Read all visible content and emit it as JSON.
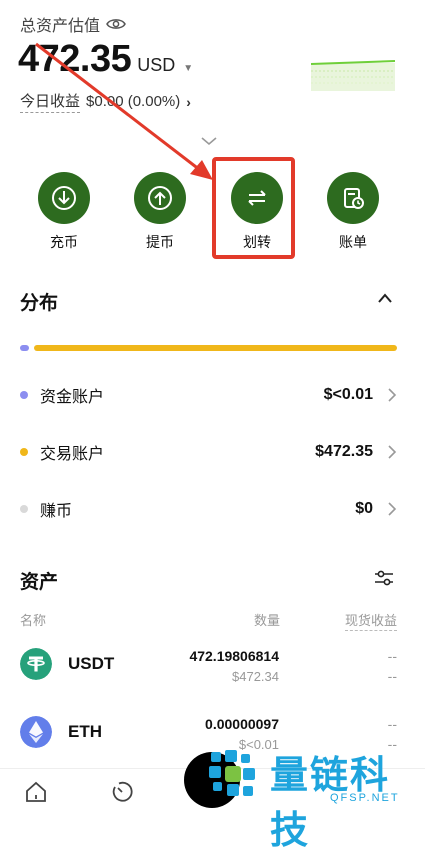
{
  "header": {
    "total_label": "总资产估值",
    "balance": "472.35",
    "currency": "USD",
    "today_pnl_label": "今日收益",
    "today_pnl_value": "$0.00 (0.00%)"
  },
  "actions": [
    {
      "label": "充币",
      "icon": "deposit-icon"
    },
    {
      "label": "提币",
      "icon": "withdraw-icon"
    },
    {
      "label": "划转",
      "icon": "transfer-icon"
    },
    {
      "label": "账单",
      "icon": "bill-icon"
    }
  ],
  "distribution": {
    "title": "分布",
    "accounts": [
      {
        "name": "资金账户",
        "amount": "$<0.01",
        "color": "#8c8ef0"
      },
      {
        "name": "交易账户",
        "amount": "$472.35",
        "color": "#f0b71a"
      },
      {
        "name": "赚币",
        "amount": "$0",
        "color": "#d9d9d9"
      }
    ]
  },
  "assets": {
    "title": "资产",
    "columns": {
      "name": "名称",
      "qty": "数量",
      "profit": "现货收益"
    },
    "rows": [
      {
        "symbol": "USDT",
        "qty": "472.19806814",
        "value": "$472.34",
        "profit1": "--",
        "profit2": "--"
      },
      {
        "symbol": "ETH",
        "qty": "0.00000097",
        "value": "$<0.01",
        "profit1": "--",
        "profit2": "--"
      }
    ]
  },
  "watermark": {
    "text": "量链科技",
    "url": "QFSP.NET"
  },
  "colors": {
    "accent_green": "#2d6b1f",
    "highlight_red": "#e23a2a",
    "watermark_blue": "#1ea4dd"
  }
}
